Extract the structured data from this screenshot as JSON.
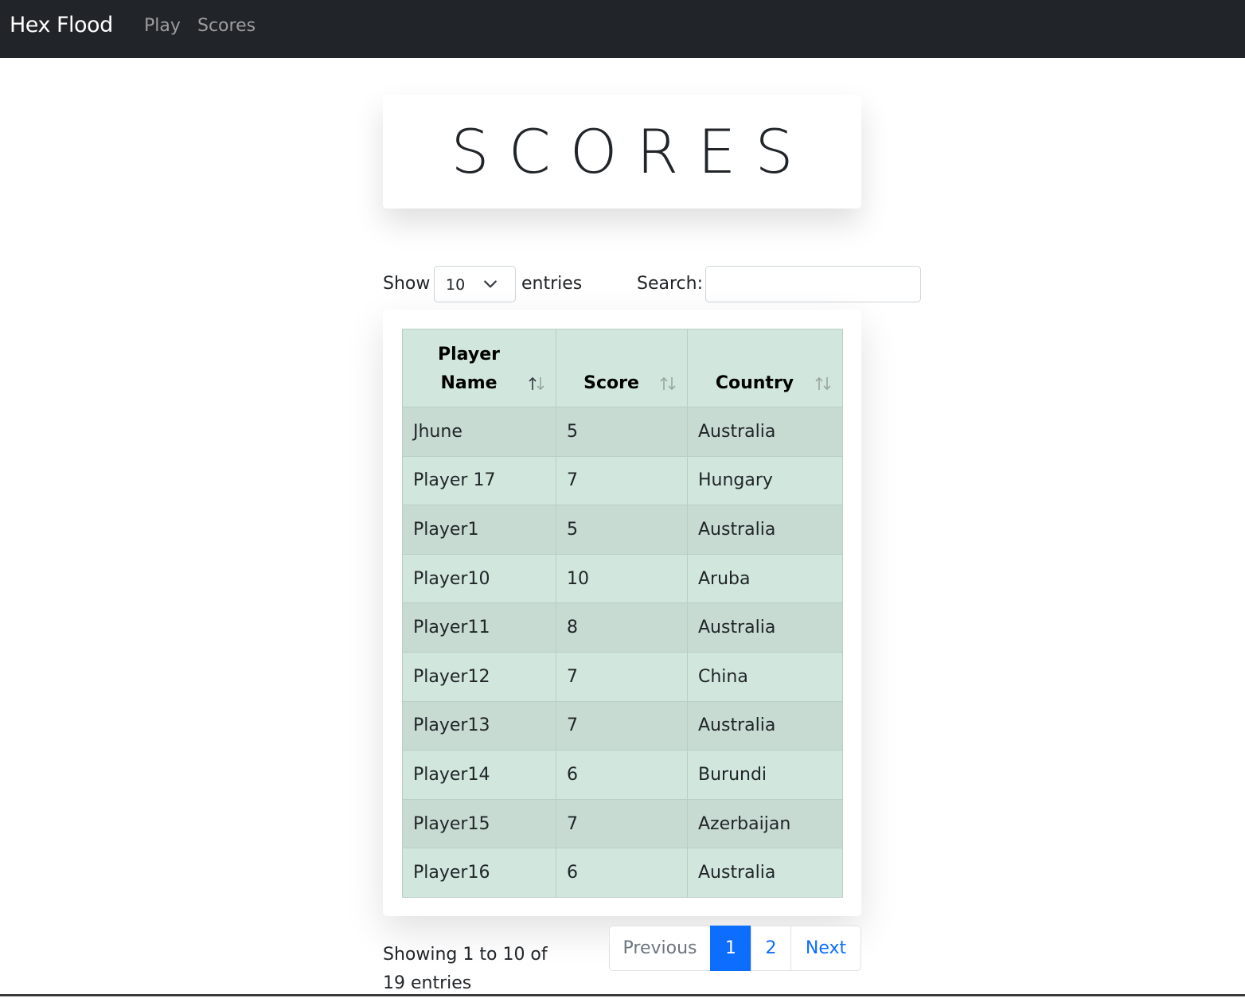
{
  "navbar": {
    "brand": "Hex Flood",
    "links": [
      {
        "label": "Play"
      },
      {
        "label": "Scores"
      }
    ]
  },
  "title": "SCORES",
  "length_control": {
    "show_label": "Show",
    "selected": "10",
    "entries_label": "entries"
  },
  "search": {
    "label": "Search:",
    "value": ""
  },
  "table": {
    "headers": [
      {
        "line1": "Player",
        "line2": "Name"
      },
      {
        "line1": "",
        "line2": "Score"
      },
      {
        "line1": "",
        "line2": "Country"
      }
    ],
    "rows": [
      {
        "name": "Jhune",
        "score": "5",
        "country": "Australia"
      },
      {
        "name": "Player 17",
        "score": "7",
        "country": "Hungary"
      },
      {
        "name": "Player1",
        "score": "5",
        "country": "Australia"
      },
      {
        "name": "Player10",
        "score": "10",
        "country": "Aruba"
      },
      {
        "name": "Player11",
        "score": "8",
        "country": "Australia"
      },
      {
        "name": "Player12",
        "score": "7",
        "country": "China"
      },
      {
        "name": "Player13",
        "score": "7",
        "country": "Australia"
      },
      {
        "name": "Player14",
        "score": "6",
        "country": "Burundi"
      },
      {
        "name": "Player15",
        "score": "7",
        "country": "Azerbaijan"
      },
      {
        "name": "Player16",
        "score": "6",
        "country": "Australia"
      }
    ]
  },
  "info": {
    "line1": "Showing 1 to 10 of",
    "line2": "19 entries"
  },
  "pagination": {
    "previous": "Previous",
    "pages": [
      "1",
      "2"
    ],
    "next": "Next",
    "active_page": "1"
  },
  "colors": {
    "navbar": "#212529",
    "table_row": "#d1e7dd",
    "table_row_striped": "#c7dbd2",
    "active_page": "#0d6efd"
  }
}
